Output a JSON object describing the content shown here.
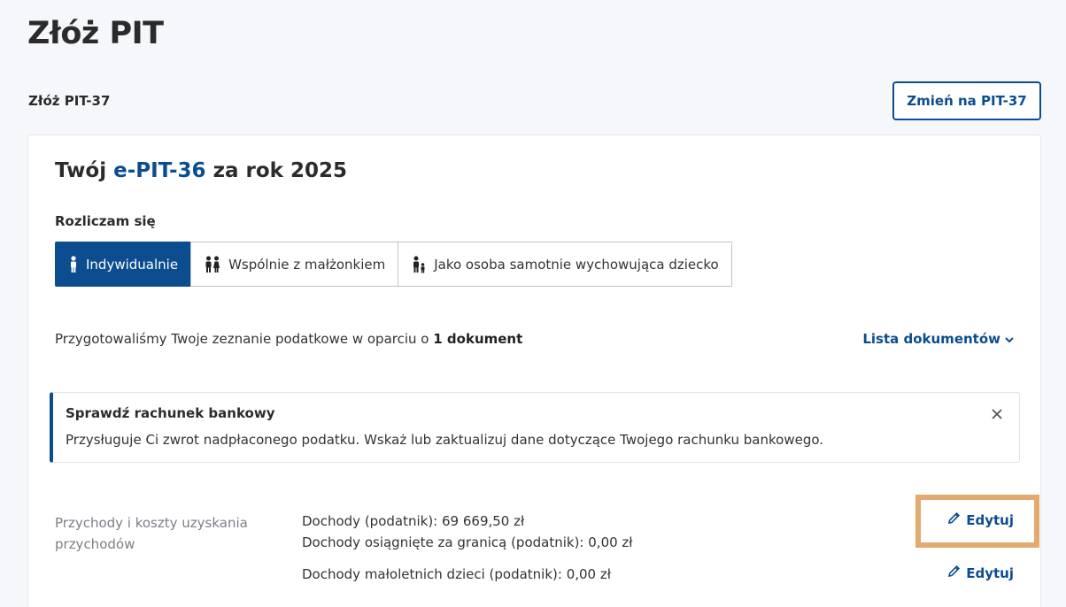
{
  "header": {
    "title": "Złóż PIT",
    "subtitle": "Złóż PIT-37",
    "switch_button": "Zmień na PIT-37"
  },
  "card": {
    "title_prefix": "Twój",
    "title_epit": "e-PIT-",
    "title_number": "36",
    "title_suffix": "za rok 2025",
    "settle_label": "Rozliczam się",
    "options": [
      {
        "label": "Indywidualnie",
        "icon": "person-icon",
        "active": true
      },
      {
        "label": "Wspólnie z małżonkiem",
        "icon": "couple-icon",
        "active": false
      },
      {
        "label": "Jako osoba samotnie wychowująca dziecko",
        "icon": "parent-child-icon",
        "active": false
      }
    ],
    "prepared_text": "Przygotowaliśmy Twoje zeznanie podatkowe w oparciu o",
    "prepared_count": "1 dokument",
    "doc_list_link": "Lista dokumentów"
  },
  "alert": {
    "title": "Sprawdź rachunek bankowy",
    "text": "Przysługuje Ci zwrot nadpłaconego podatku. Wskaż lub zaktualizuj dane dotyczące Twojego rachunku bankowego."
  },
  "income": {
    "label": "Przychody i koszty uzyskania przychodów",
    "rows": [
      "Dochody (podatnik):  69 669,50 zł",
      "Dochody osiągnięte za granicą (podatnik): 0,00 zł",
      "Dochody małoletnich dzieci (podatnik): 0,00 zł"
    ],
    "edit_label": "Edytuj"
  },
  "colors": {
    "primary": "#0b4d8f",
    "highlight": "#e3a96d"
  }
}
